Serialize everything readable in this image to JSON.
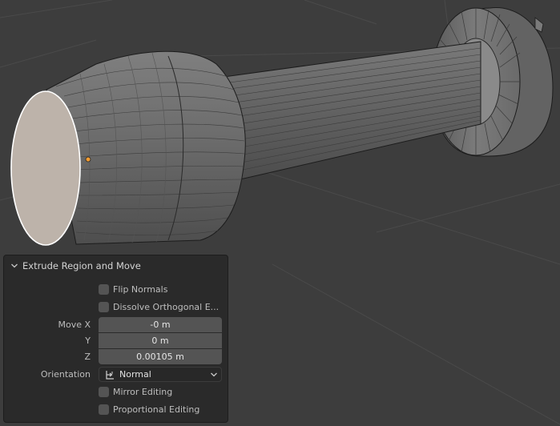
{
  "panel": {
    "title": "Extrude Region and Move",
    "flip_normals": {
      "label": "Flip Normals",
      "checked": false
    },
    "dissolve_orthogonal": {
      "label": "Dissolve Orthogonal E...",
      "checked": false
    },
    "move": {
      "x_label": "Move X",
      "x_value": "-0 m",
      "y_label": "Y",
      "y_value": "0 m",
      "z_label": "Z",
      "z_value": "0.00105 m"
    },
    "orientation": {
      "label": "Orientation",
      "value": "Normal"
    },
    "mirror_editing": {
      "label": "Mirror Editing",
      "checked": false
    },
    "proportional_editing": {
      "label": "Proportional Editing",
      "checked": false
    }
  },
  "icons": {
    "collapse": "chevron-down-icon",
    "orientation": "orientation-normal-icon",
    "dropdown": "chevron-down-icon"
  },
  "colors": {
    "viewport_bg": "#3d3d3d",
    "panel_bg": "#2a2a2a",
    "field_bg": "#545454",
    "selected_face": "#bdb3aa",
    "mesh_gray": "#6a6a6a",
    "selection_white": "#ffffff",
    "origin_orange": "#f29c32"
  }
}
